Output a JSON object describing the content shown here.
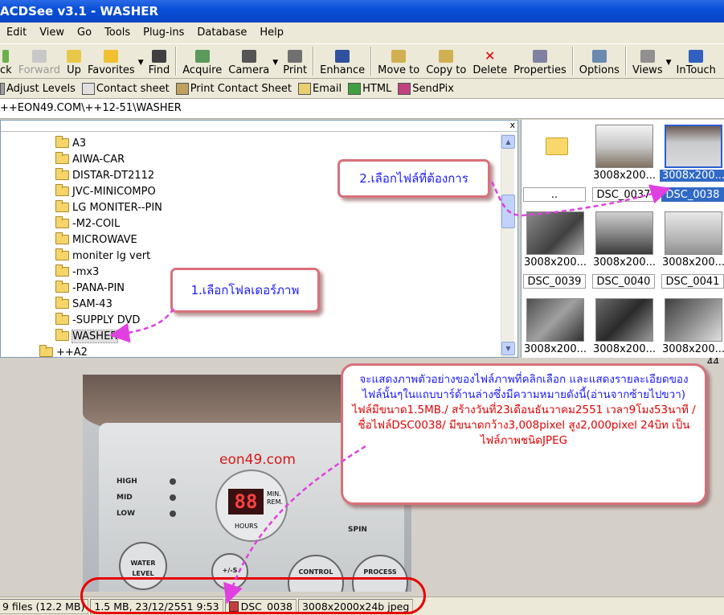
{
  "window": {
    "title": "ACDSee v3.1 - WASHER"
  },
  "menu": [
    "Edit",
    "View",
    "Go",
    "Tools",
    "Plug-ins",
    "Database",
    "Help"
  ],
  "toolbar": {
    "back": "ck",
    "forward": "Forward",
    "up": "Up",
    "favorites": "Favorites",
    "find": "Find",
    "acquire": "Acquire",
    "camera": "Camera",
    "print": "Print",
    "enhance": "Enhance",
    "move_to": "Move to",
    "copy_to": "Copy to",
    "delete": "Delete",
    "properties": "Properties",
    "options": "Options",
    "views": "Views",
    "intouch": "InTouch"
  },
  "toolbar2": {
    "adjust_levels": "Adjust Levels",
    "contact_sheet": "Contact sheet",
    "print_contact_sheet": "Print Contact Sheet",
    "email": "Email",
    "html": "HTML",
    "sendpix": "SendPix"
  },
  "address": "++EON49.COM\\++12-51\\WASHER",
  "tree": {
    "close": "x",
    "items": [
      "A3",
      "AIWA-CAR",
      "DISTAR-DT2112",
      "JVC-MINICOMPO",
      "LG MONITER--PIN",
      "-M2-COIL",
      "MICROWAVE",
      "moniter lg vert",
      "-mx3",
      "-PANA-PIN",
      "SAM-43",
      "-SUPPLY DVD",
      "WASHER"
    ],
    "parent_item": "++A2"
  },
  "thumbnails": {
    "parent_label": "..",
    "items": [
      {
        "dim": "3008x200...",
        "name": "DSC_0037"
      },
      {
        "dim": "3008x200...",
        "name": "DSC_0038"
      },
      {
        "dim": "3008x200...",
        "name": "DSC_0039"
      },
      {
        "dim": "3008x200...",
        "name": "DSC_0040"
      },
      {
        "dim": "3008x200...",
        "name": "DSC_0041"
      },
      {
        "dim": "3008x200...",
        "name": ""
      },
      {
        "dim": "3008x200...",
        "name": ""
      },
      {
        "dim": "3008x200...",
        "name": ""
      }
    ],
    "overflow_text": "44"
  },
  "preview": {
    "watermark": "eon49.com",
    "led": "88",
    "min_rem": "MIN.\nREM.",
    "hours": "HOURS",
    "high": "HIGH",
    "mid": "MID",
    "low": "LOW",
    "spin": "SPIN",
    "water_level": "WATER\nLEVEL",
    "plus": "+/-S",
    "control": "CONTROL",
    "process": "PROCESS"
  },
  "callouts": {
    "step1": "1.เลือกโฟลเดอร์ภาพ",
    "step2": "2.เลือกไฟล์ที่ต้องการ",
    "info_blue": "จะแสดงภาพตัวอย่างของไฟล์ภาพที่คลิกเลือก และแสดงรายละเอียดของไฟล์นั้นๆในแถบบาร์ด้านล่างซึ่งมีความหมายดังนี้(อ่านจากซ้ายไปขวา)",
    "info_red": "ไฟล์มีขนาด1.5MB./ สร้างวันที่23เดือนธันวาคม2551 เวลา9โมง53นาที /ชื่อไฟล์DSC0038/ มีขนาดกว้าง3,008pixel สูง2,000pixel 24บิท เป็นไฟล์ภาพชนิดJPEG"
  },
  "status": {
    "files": "9 files (12.2 MB)",
    "size_date": "1.5 MB, 23/12/2551 9:53",
    "filename": "DSC_0038",
    "dimensions": "3008x2000x24b jpeg"
  },
  "colors": {
    "titlebar": "#0a4fd8",
    "selection": "#316ac5",
    "callout_border": "#d9707a",
    "arrow": "#e040e0",
    "highlight": "#e80000"
  }
}
